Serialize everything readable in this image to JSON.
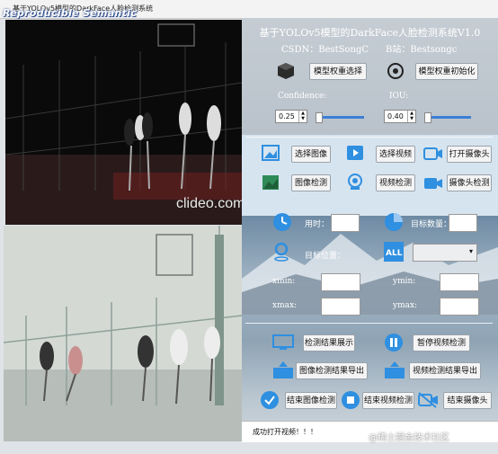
{
  "window": {
    "title": "基于YOLOv5模型的DarkFace人脸检测系统",
    "logo_text": "Reproducible Semantic"
  },
  "video": {
    "watermark": "clideo.com"
  },
  "header": {
    "title": "基于YOLOv5模型的DarkFace人脸检测系统V1.0",
    "csdn": "CSDN：BestSongC",
    "bilibili": "B站：Bestsongc"
  },
  "model": {
    "select_label": "模型权重选择",
    "init_label": "模型权重初始化"
  },
  "params": {
    "confidence_label": "Confidence:",
    "iou_label": "IOU:",
    "confidence_value": "0.25",
    "iou_value": "0.40",
    "confidence_level": 0.25,
    "iou_level": 0.4
  },
  "actions": {
    "select_image": "选择图像",
    "select_video": "选择视频",
    "open_camera": "打开摄像头",
    "image_detect": "图像检测",
    "video_detect": "视频检测",
    "camera_detect": "摄像头检测"
  },
  "results": {
    "time_label": "用时：",
    "count_label": "目标数量：",
    "position_label": "目标位置：",
    "xmin_label": "xmin:",
    "ymin_label": "ymin:",
    "xmax_label": "xmax:",
    "ymax_label": "ymax:"
  },
  "controls": {
    "show_results": "检测结果展示",
    "pause_video": "暂停视频检测",
    "export_image": "图像检测结果导出",
    "export_video": "视频检测结果导出",
    "end_image": "结束图像检测",
    "end_video": "结束视频检测",
    "end_camera": "结束摄像头"
  },
  "status": {
    "message": "成功打开视频！！！"
  },
  "site_watermark": "@稀土掘金技术社区",
  "colors": {
    "accent": "#3b7fd6",
    "icon_blue": "#2f8fe0",
    "panel_sky": "#8ea3b4"
  }
}
